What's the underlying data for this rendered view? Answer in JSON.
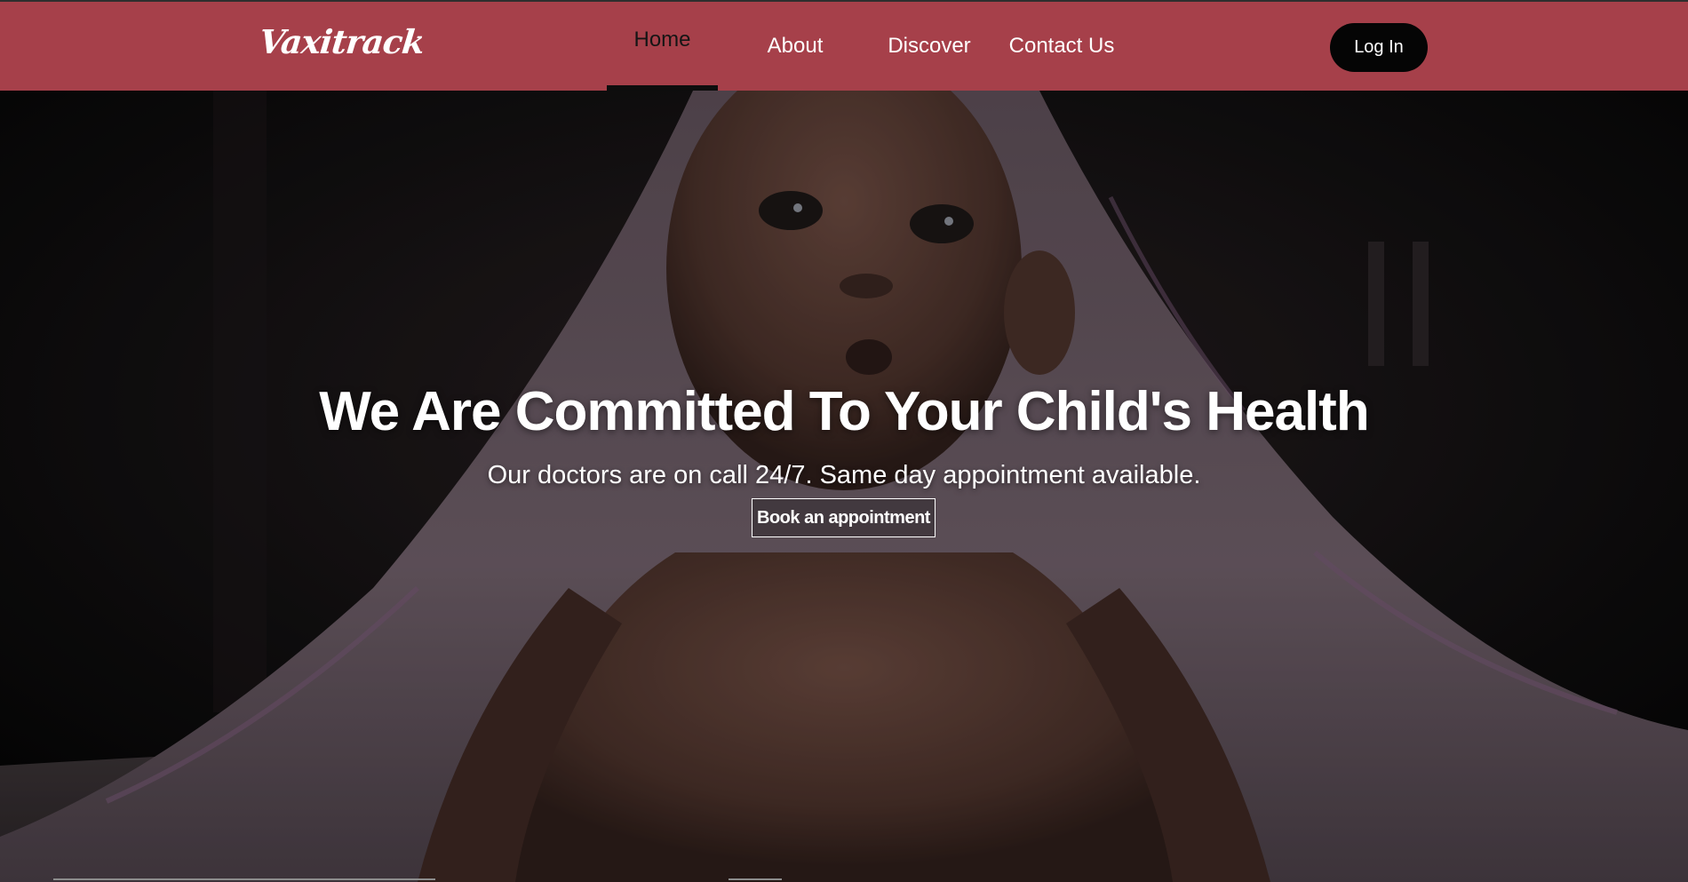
{
  "navbar": {
    "brand": "Vaxitrack",
    "items": [
      {
        "label": "Home",
        "active": true
      },
      {
        "label": "About",
        "active": false
      },
      {
        "label": "Discover",
        "active": false
      },
      {
        "label": "Contact Us",
        "active": false
      }
    ],
    "login_label": "Log In"
  },
  "hero": {
    "title": "We Are Committed To Your Child's Health",
    "subtitle": "Our doctors are on call 24/7. Same day appointment available.",
    "cta_label": "Book an appointment",
    "image": "baby-under-blanket-photo"
  },
  "colors": {
    "navbar_bg": "#a6404a",
    "login_bg": "#050505",
    "text": "#ffffff"
  }
}
